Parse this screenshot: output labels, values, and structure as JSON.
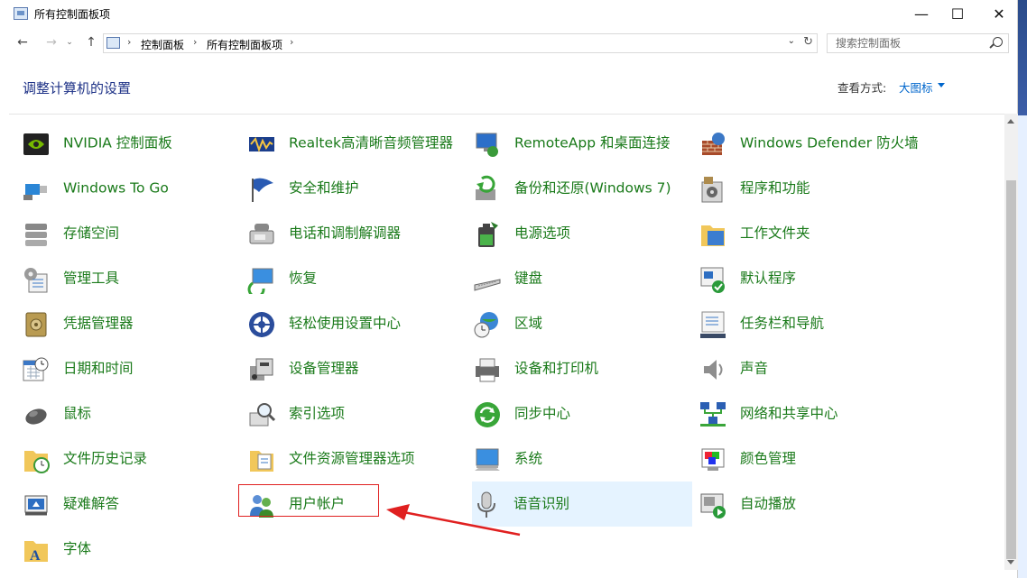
{
  "window": {
    "title": "所有控制面板项",
    "controls": {
      "minimize": "—",
      "maximize": "☐",
      "close": "✕"
    }
  },
  "nav": {
    "back": "←",
    "forward": "→",
    "recent": "⌄",
    "up": "↑",
    "breadcrumbs": [
      "控制面板",
      "所有控制面板项"
    ],
    "separator": "›",
    "dropdown": "⌄",
    "refresh": "↻"
  },
  "search": {
    "placeholder": "搜索控制面板"
  },
  "header": {
    "title": "调整计算机的设置",
    "view_by_label": "查看方式:",
    "view_by_value": "大图标"
  },
  "items": [
    {
      "label": "NVIDIA 控制面板",
      "icon": "nvidia-icon"
    },
    {
      "label": "Realtek高清晰音频管理器",
      "icon": "realtek-audio-icon"
    },
    {
      "label": "RemoteApp 和桌面连接",
      "icon": "remoteapp-icon"
    },
    {
      "label": "Windows Defender 防火墙",
      "icon": "firewall-icon"
    },
    {
      "label": "Windows To Go",
      "icon": "usb-drive-icon"
    },
    {
      "label": "安全和维护",
      "icon": "flag-icon"
    },
    {
      "label": "备份和还原(Windows 7)",
      "icon": "backup-icon"
    },
    {
      "label": "程序和功能",
      "icon": "programs-icon"
    },
    {
      "label": "存储空间",
      "icon": "storage-icon"
    },
    {
      "label": "电话和调制解调器",
      "icon": "phone-modem-icon"
    },
    {
      "label": "电源选项",
      "icon": "battery-icon"
    },
    {
      "label": "工作文件夹",
      "icon": "work-folder-icon"
    },
    {
      "label": "管理工具",
      "icon": "admin-tools-icon"
    },
    {
      "label": "恢复",
      "icon": "recovery-icon"
    },
    {
      "label": "键盘",
      "icon": "keyboard-icon"
    },
    {
      "label": "默认程序",
      "icon": "default-programs-icon"
    },
    {
      "label": "凭据管理器",
      "icon": "credential-vault-icon"
    },
    {
      "label": "轻松使用设置中心",
      "icon": "ease-of-access-icon"
    },
    {
      "label": "区域",
      "icon": "globe-clock-icon"
    },
    {
      "label": "任务栏和导航",
      "icon": "taskbar-icon"
    },
    {
      "label": "日期和时间",
      "icon": "calendar-clock-icon"
    },
    {
      "label": "设备管理器",
      "icon": "device-manager-icon"
    },
    {
      "label": "设备和打印机",
      "icon": "printer-icon"
    },
    {
      "label": "声音",
      "icon": "speaker-icon"
    },
    {
      "label": "鼠标",
      "icon": "mouse-icon"
    },
    {
      "label": "索引选项",
      "icon": "index-search-icon"
    },
    {
      "label": "同步中心",
      "icon": "sync-icon"
    },
    {
      "label": "网络和共享中心",
      "icon": "network-icon"
    },
    {
      "label": "文件历史记录",
      "icon": "file-history-icon"
    },
    {
      "label": "文件资源管理器选项",
      "icon": "folder-options-icon"
    },
    {
      "label": "系统",
      "icon": "system-icon"
    },
    {
      "label": "颜色管理",
      "icon": "color-management-icon"
    },
    {
      "label": "疑难解答",
      "icon": "troubleshoot-icon"
    },
    {
      "label": "用户帐户",
      "icon": "user-accounts-icon"
    },
    {
      "label": "语音识别",
      "icon": "microphone-icon"
    },
    {
      "label": "自动播放",
      "icon": "autoplay-icon"
    },
    {
      "label": "字体",
      "icon": "fonts-icon"
    }
  ],
  "hovered_item": "语音识别",
  "annotated_item": "用户帐户",
  "colors": {
    "item_text": "#1a7a1a",
    "heading": "#1e3287",
    "link": "#0066cc",
    "annotation": "#e02020",
    "hover_bg": "#e5f3ff"
  }
}
